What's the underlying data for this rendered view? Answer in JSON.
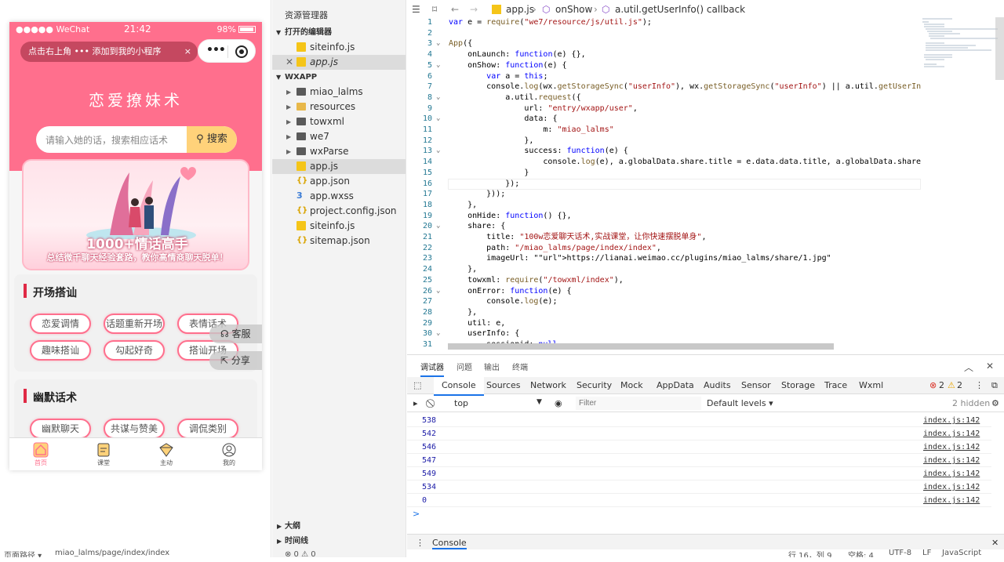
{
  "phone": {
    "status": {
      "signal": "●●●●● WeChat",
      "time": "21:42",
      "battery": "98%"
    },
    "tip": {
      "text": "点击右上角 ••• 添加到我的小程序",
      "close": "×"
    },
    "title": "恋爱撩妹术",
    "search": {
      "placeholder": "请输入她的话，搜索相应话术",
      "button": "搜索"
    },
    "banner": {
      "headline": "1000+情话高手",
      "subline": "总结微千聊天经验套路，教你高情商聊天脱单！"
    },
    "section1": {
      "title": "开场搭讪",
      "pills": [
        "恋爱调情",
        "话题重新开场",
        "表情话术",
        "趣味搭讪",
        "勾起好奇",
        "搭讪开场"
      ]
    },
    "section2": {
      "title": "幽默话术",
      "pills": [
        "幽默聊天",
        "共谋与赞美",
        "调侃类别"
      ]
    },
    "floats": {
      "service": "客服",
      "share": "分享"
    },
    "tabs": [
      {
        "label": "首页",
        "icon": "home-icon"
      },
      {
        "label": "课堂",
        "icon": "book-icon"
      },
      {
        "label": "主动",
        "icon": "gem-icon"
      },
      {
        "label": "我的",
        "icon": "user-icon"
      }
    ],
    "colors": {
      "brand": "#ff6f8d",
      "search_button": "#ffd27a",
      "accent_bar": "#e02a45"
    }
  },
  "sim_footer": {
    "path_label": "页面路径 ▾",
    "path": "miao_lalms/page/index/index"
  },
  "explorer": {
    "title": "资源管理器",
    "open_editors_label": "打开的编辑器",
    "open_editors": [
      "siteinfo.js",
      "app.js"
    ],
    "project_label": "WXAPP",
    "files": [
      {
        "name": "miao_lalms",
        "type": "folder"
      },
      {
        "name": "resources",
        "type": "folderY"
      },
      {
        "name": "towxml",
        "type": "folder"
      },
      {
        "name": "we7",
        "type": "folder"
      },
      {
        "name": "wxParse",
        "type": "folder"
      },
      {
        "name": "app.js",
        "type": "js"
      },
      {
        "name": "app.json",
        "type": "json"
      },
      {
        "name": "app.wxss",
        "type": "css"
      },
      {
        "name": "project.config.json",
        "type": "json"
      },
      {
        "name": "siteinfo.js",
        "type": "js"
      },
      {
        "name": "sitemap.json",
        "type": "json"
      }
    ],
    "outline_label": "大纲",
    "timeline_label": "时间线",
    "problems": "⊗ 0 ⚠ 0"
  },
  "editor": {
    "crumbs": {
      "file": "app.js",
      "fn1": "onShow",
      "fn2": "a.util.getUserInfo() callback"
    },
    "lines": [
      "var e = require(\"we7/resource/js/util.js\");",
      "",
      "App({",
      "    onLaunch: function(e) {},",
      "    onShow: function(e) {",
      "        var a = this;",
      "        console.log(wx.getStorageSync(\"userInfo\"), wx.getStorageSync(\"userInfo\") || a.util.getUserInfo(fun",
      "            a.util.request({",
      "                url: \"entry/wxapp/user\",",
      "                data: {",
      "                    m: \"miao_lalms\"",
      "                },",
      "                success: function(e) {",
      "                    console.log(e), a.globalData.share.title = e.data.data.title, a.globalData.share.imageU",
      "                }",
      "            });",
      "        }));",
      "    },",
      "    onHide: function() {},",
      "    share: {",
      "        title: \"100w恋爱聊天话术,实战课堂，让你快速摆脱单身\",",
      "        path: \"/miao_lalms/page/index/index\",",
      "        imageUrl: \"https://lianai.weimao.cc/plugins/miao_lalms/share/1.jpg\"",
      "    },",
      "    towxml: require(\"/towxml/index\"),",
      "    onError: function(e) {",
      "        console.log(e);",
      "    },",
      "    util: e,",
      "    userInfo: {",
      "        sessionid: null"
    ],
    "fold_lines": [
      3,
      5,
      8,
      10,
      13,
      20,
      26,
      30
    ]
  },
  "devtools": {
    "top_tabs": [
      "调试器",
      "问题",
      "输出",
      "终端"
    ],
    "tabs": [
      "Console",
      "Sources",
      "Network",
      "Security",
      "Mock",
      "AppData",
      "Audits",
      "Sensor",
      "Storage",
      "Trace",
      "Wxml"
    ],
    "errors": "2",
    "warnings": "2",
    "context": "top",
    "filter_placeholder": "Filter",
    "levels": "Default levels ▾",
    "hidden": "2 hidden",
    "logs": [
      {
        "value": "538",
        "src": "index.js:142"
      },
      {
        "value": "542",
        "src": "index.js:142"
      },
      {
        "value": "546",
        "src": "index.js:142"
      },
      {
        "value": "547",
        "src": "index.js:142"
      },
      {
        "value": "549",
        "src": "index.js:142"
      },
      {
        "value": "534",
        "src": "index.js:142"
      },
      {
        "value": "0",
        "src": "index.js:142"
      }
    ],
    "prompt": ">",
    "drawer_tab": "Console"
  },
  "statusbar": {
    "pos": "行 16，列 9",
    "spaces": "空格: 4",
    "encoding": "UTF-8",
    "eol": "LF",
    "lang": "JavaScript"
  }
}
